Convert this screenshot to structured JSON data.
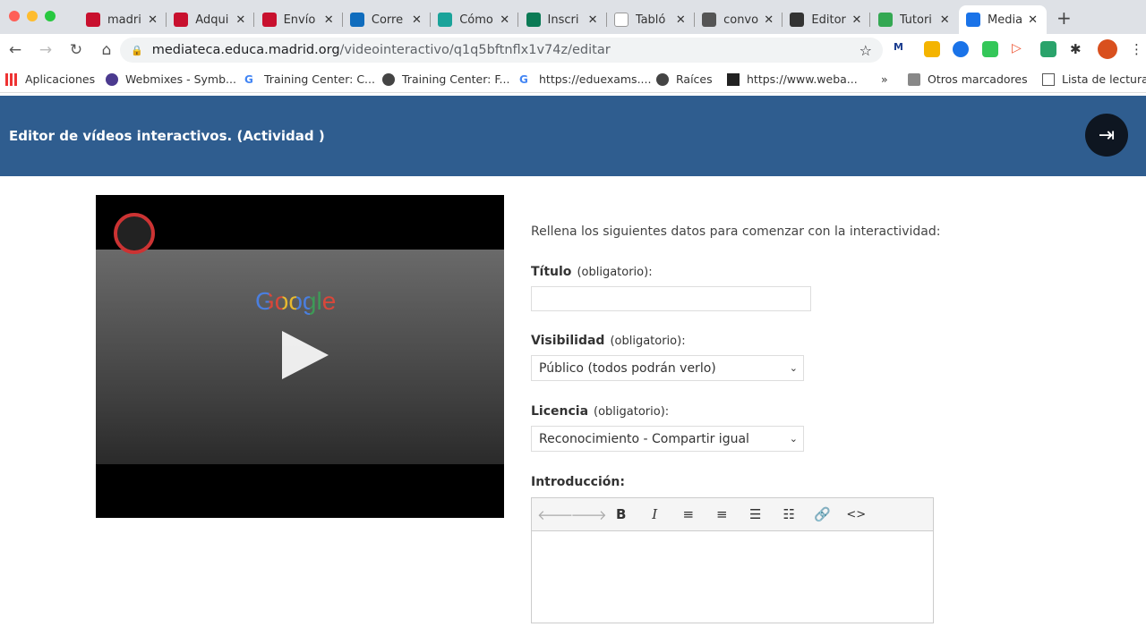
{
  "browser": {
    "tabs": [
      {
        "title": "madri",
        "color": "#c8102e"
      },
      {
        "title": "Adqui",
        "color": "#c8102e"
      },
      {
        "title": "Envío",
        "color": "#c8102e"
      },
      {
        "title": "Corre",
        "color": "#0f6cbd"
      },
      {
        "title": "Cómo",
        "color": "#1aa39a"
      },
      {
        "title": "Inscri",
        "color": "#0b7a55"
      },
      {
        "title": "Tabló",
        "color": "#ffffff"
      },
      {
        "title": "convo",
        "color": "#555555"
      },
      {
        "title": "Editor",
        "color": "#333333"
      },
      {
        "title": "Tutori",
        "color": "#34a853"
      },
      {
        "title": "Media",
        "color": "#1a73e8"
      }
    ],
    "close_glyph": "✕",
    "new_tab": "+",
    "url_host": "mediateca.educa.madrid.org",
    "url_path": "/videointeractivo/q1q5bftnflx1v74z/editar",
    "bookmarks": [
      "Aplicaciones",
      "Webmixes - Symb...",
      "Training Center: C...",
      "Training Center: F...",
      "https://eduexams....",
      "Raíces",
      "https://www.weba..."
    ],
    "more": "»",
    "other_bookmarks": "Otros marcadores",
    "reading_list": "Lista de lectura"
  },
  "header": {
    "title": "Editor de vídeos interactivos. (Actividad )",
    "exit_icon": "⇥"
  },
  "video": {
    "logo_text": "Google"
  },
  "form": {
    "intro": "Rellena los siguientes datos para comenzar con la interactividad:",
    "title_label": "Título",
    "required": "(obligatorio):",
    "title_value": "",
    "visibility_label": "Visibilidad",
    "visibility_value": "Público (todos podrán verlo)",
    "license_label": "Licencia",
    "license_value": "Reconocimiento - Compartir igual",
    "introduction_label": "Introducción:"
  },
  "editor_toolbar": [
    "🡐",
    "🡒",
    "B",
    "I",
    "≡",
    "≡",
    "☰",
    "☷",
    "🔗",
    "<>"
  ]
}
